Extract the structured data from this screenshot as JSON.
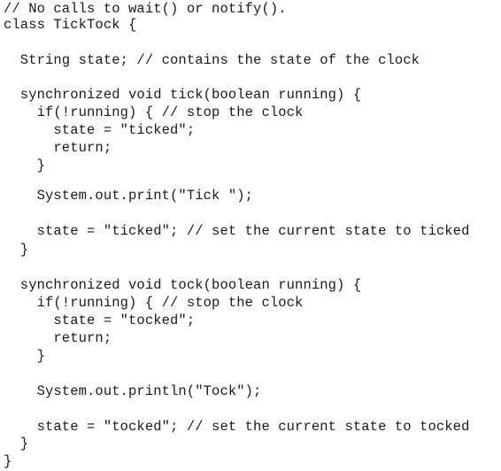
{
  "code": {
    "lines": [
      "// No calls to wait() or notify().",
      "class TickTock {",
      "",
      "  String state; // contains the state of the clock",
      "",
      "  synchronized void tick(boolean running) {",
      "    if(!running) { // stop the clock",
      "      state = \"ticked\";",
      "      return;",
      "    }",
      "",
      "    System.out.print(\"Tick \");",
      "",
      "    state = \"ticked\"; // set the current state to ticked",
      "  }",
      "",
      "  synchronized void tock(boolean running) {",
      "    if(!running) { // stop the clock",
      "      state = \"tocked\";",
      "      return;",
      "    }",
      "",
      "    System.out.println(\"Tock\");",
      "",
      "    state = \"tocked\"; // set the current state to tocked",
      "  }",
      "}"
    ]
  }
}
